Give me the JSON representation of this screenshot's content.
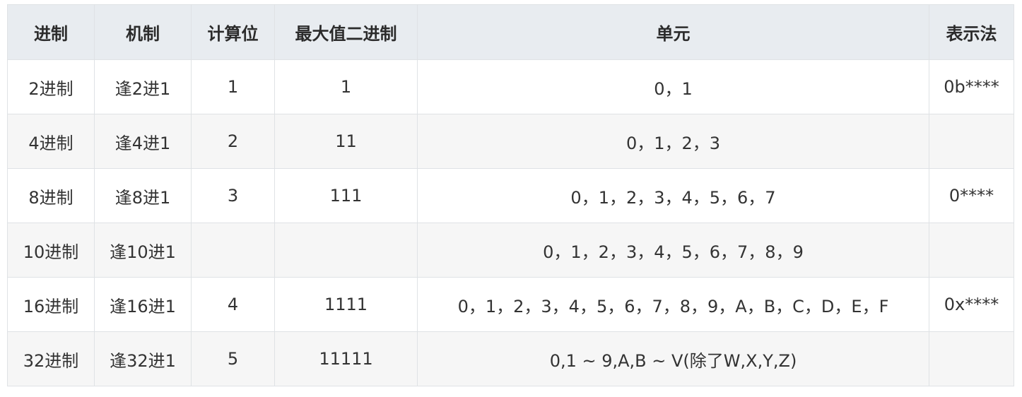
{
  "table": {
    "headers": [
      "进制",
      "机制",
      "计算位",
      "最大值二进制",
      "单元",
      "表示法"
    ],
    "rows": [
      [
        "2进制",
        "逢2进1",
        "1",
        "1",
        "0，1",
        "0b****"
      ],
      [
        "4进制",
        "逢4进1",
        "2",
        "11",
        "0，1，2，3",
        ""
      ],
      [
        "8进制",
        "逢8进1",
        "3",
        "111",
        "0，1，2，3，4，5，6，7",
        "0****"
      ],
      [
        "10进制",
        "逢10进1",
        "",
        "",
        "0，1，2，3，4，5，6，7，8，9",
        ""
      ],
      [
        "16进制",
        "逢16进1",
        "4",
        "1111",
        "0，1，2，3，4，5，6，7，8，9，A，B，C，D，E，F",
        "0x****"
      ],
      [
        "32进制",
        "逢32进1",
        "5",
        "11111",
        "0,1 ~ 9,A,B ~ V(除了W,X,Y,Z)",
        ""
      ]
    ]
  }
}
